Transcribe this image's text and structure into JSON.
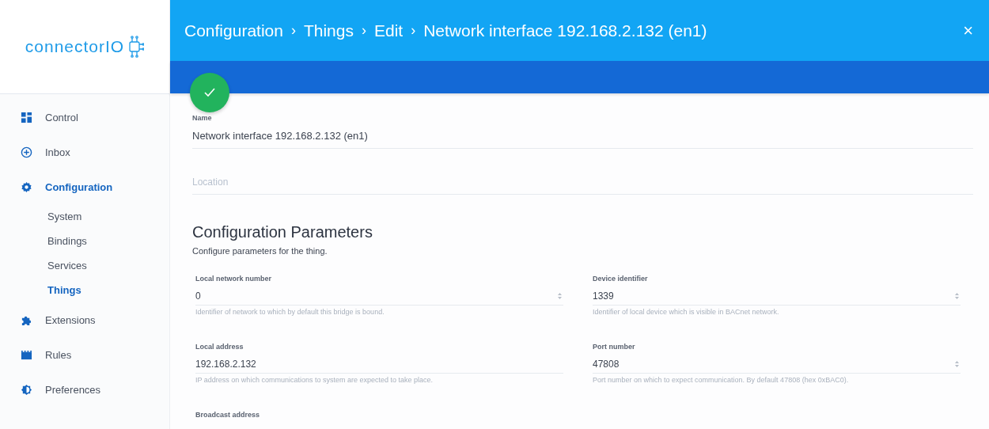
{
  "sidebar": {
    "logo": "connectorIO",
    "items": [
      {
        "label": "Control",
        "selected": false,
        "kind": "item"
      },
      {
        "label": "Inbox",
        "selected": false,
        "kind": "item"
      },
      {
        "label": "Configuration",
        "selected": true,
        "kind": "item"
      },
      {
        "label": "System",
        "selected": false,
        "kind": "subitem"
      },
      {
        "label": "Bindings",
        "selected": false,
        "kind": "subitem"
      },
      {
        "label": "Services",
        "selected": false,
        "kind": "subitem"
      },
      {
        "label": "Things",
        "selected": true,
        "kind": "subitem"
      },
      {
        "label": "Extensions",
        "selected": false,
        "kind": "item"
      },
      {
        "label": "Rules",
        "selected": false,
        "kind": "item"
      },
      {
        "label": "Preferences",
        "selected": false,
        "kind": "item"
      }
    ]
  },
  "header": {
    "breadcrumb": [
      "Configuration",
      "Things",
      "Edit",
      "Network interface 192.168.2.132 (en1)"
    ],
    "separator": "›",
    "close": "×"
  },
  "form": {
    "name": {
      "label": "Name",
      "value": "Network interface 192.168.2.132 (en1)"
    },
    "location": {
      "placeholder": "Location"
    },
    "section_title": "Configuration Parameters",
    "section_description": "Configure parameters for the thing.",
    "parameters": [
      {
        "label": "Local network number",
        "value": "0",
        "kind": "number",
        "hint": "Identifier of network to which by default this bridge is bound."
      },
      {
        "label": "Device identifier",
        "value": "1339",
        "kind": "number",
        "hint": "Identifier of local device which is visible in BACnet network."
      },
      {
        "label": "Local address",
        "value": "192.168.2.132",
        "kind": "text",
        "hint": "IP address on which communications to system are expected to take place."
      },
      {
        "label": "Port number",
        "value": "47808",
        "kind": "number",
        "hint": "Port number on which to expect communication. By default 47808 (hex 0xBAC0)."
      },
      {
        "label": "Broadcast address"
      }
    ]
  }
}
